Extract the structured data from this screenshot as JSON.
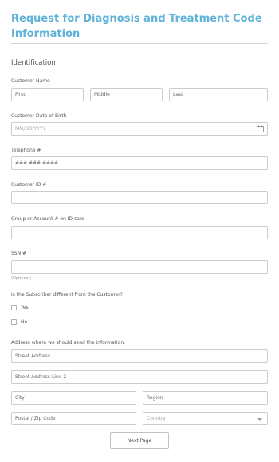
{
  "form": {
    "title": "Request for Diagnosis and Treatment Code Information",
    "section": "Identification",
    "customer_name": {
      "label": "Customer Name",
      "first_placeholder": "First",
      "middle_placeholder": "Middle",
      "last_placeholder": "Last"
    },
    "dob": {
      "label": "Customer Date of Birth",
      "placeholder": "MM/DD/YYYY"
    },
    "telephone": {
      "label": "Telephone #",
      "placeholder": "### ### ####"
    },
    "customer_id": {
      "label": "Customer ID #",
      "value": ""
    },
    "group_account": {
      "label": "Group or Account # on ID card",
      "value": ""
    },
    "ssn": {
      "label": "SSN #",
      "value": "",
      "sublabel": "(Optional)"
    },
    "subscriber": {
      "question": "Is the Subscriber different from the Customer?",
      "options": [
        "Yes",
        "No"
      ],
      "checked": [
        false,
        false
      ]
    },
    "address": {
      "label": "Address where we should send the information:",
      "street_placeholder": "Street Address",
      "street2_placeholder": "Street Address Line 2",
      "city_placeholder": "City",
      "region_placeholder": "Region",
      "postal_placeholder": "Postal / Zip Code",
      "country_placeholder": "Country"
    },
    "next_button": "Next Page"
  },
  "icons": {
    "calendar": "calendar-icon",
    "dropdown": "chevron-down-icon"
  },
  "colors": {
    "title": "#5fb3d9",
    "border": "#c9ccd1",
    "placeholder": "#666666",
    "muted": "#a6a6a6"
  }
}
